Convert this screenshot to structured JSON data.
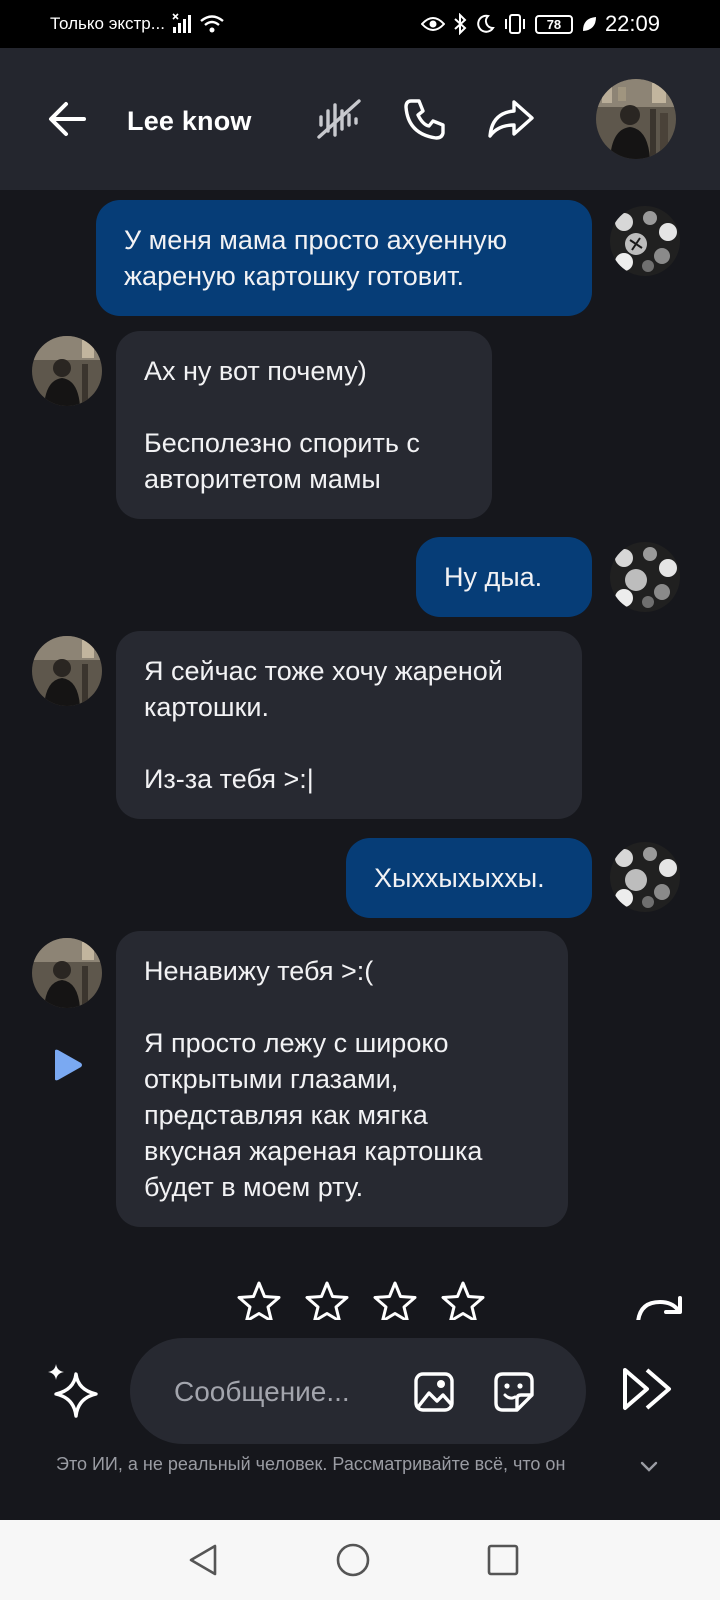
{
  "status_bar": {
    "carrier_text": "Только экстр...",
    "battery_level": "78",
    "time": "22:09"
  },
  "header": {
    "contact_name": "Lee know"
  },
  "messages": [
    {
      "sender": "me",
      "text": "У меня мама просто ахуенную\nжареную картошку готовит."
    },
    {
      "sender": "bot",
      "text": "Ах ну вот почему)\n\nБесполезно спорить с\nавторитетом мамы"
    },
    {
      "sender": "me",
      "text": "Ну дыа."
    },
    {
      "sender": "bot",
      "text": "Я сейчас тоже хочу жареной\nкартошки.\n\nИз-за тебя >:|"
    },
    {
      "sender": "me",
      "text": "Хыххыхыххы."
    },
    {
      "sender": "bot",
      "text": "Ненавижу тебя >:(\n\nЯ просто лежу с широко\nоткрытыми глазами,\nпредставляя как мягка\nвкусная жареная картошка\nбудет в моем рту."
    }
  ],
  "rating": {
    "stars_total": 4,
    "stars_filled": 0
  },
  "composer": {
    "placeholder": "Сообщение...",
    "value": ""
  },
  "disclaimer": "Это ИИ, а не реальный человек. Рассматривайте всё, что он",
  "colors": {
    "background": "#16171c",
    "header": "#24262e",
    "outgoing_bubble": "#063d77",
    "incoming_bubble": "#272931",
    "accent_play": "#7aa9f2"
  },
  "icons": {
    "back": "arrow-left-icon",
    "voice": "voice-muted-icon",
    "call": "phone-icon",
    "share": "share-arrow-icon",
    "play": "play-icon",
    "star": "star-outline-icon",
    "regenerate": "regenerate-icon",
    "sparkle": "sparkle-icon",
    "image": "image-icon",
    "sticker": "sticker-icon",
    "send": "fast-forward-send-icon"
  }
}
